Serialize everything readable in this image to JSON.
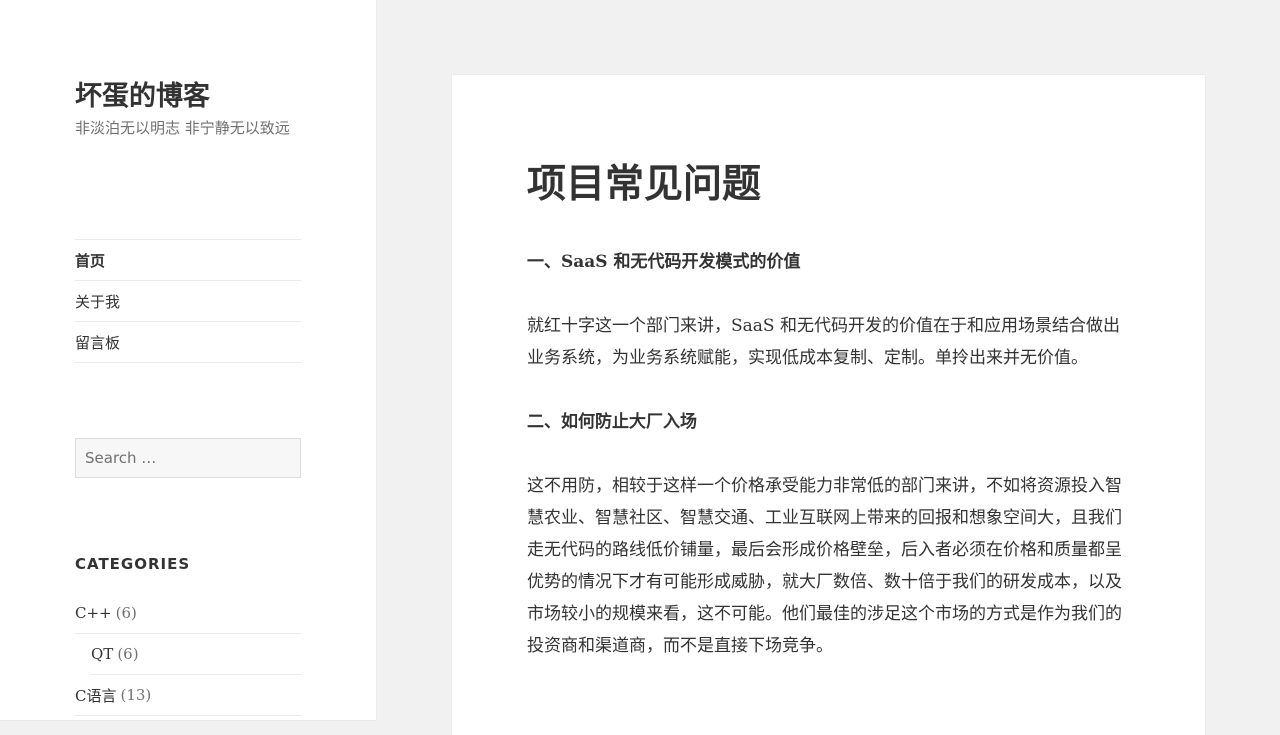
{
  "site": {
    "title": "坏蛋的博客",
    "description": "非淡泊无以明志 非宁静无以致远"
  },
  "nav": {
    "items": [
      {
        "label": "首页"
      },
      {
        "label": "关于我"
      },
      {
        "label": "留言板"
      }
    ]
  },
  "search": {
    "placeholder": "Search …"
  },
  "categories": {
    "title": "CATEGORIES",
    "items": [
      {
        "name": "C++",
        "count": "(6)"
      },
      {
        "name": "QT",
        "count": "(6)"
      },
      {
        "name": "C语言",
        "count": "(13)"
      }
    ]
  },
  "post": {
    "title": "项目常见问题",
    "sections": [
      {
        "heading": "一、SaaS 和无代码开发模式的价值",
        "paragraph": "就红十字这一个部门来讲，SaaS 和无代码开发的价值在于和应用场景结合做出业务系统，为业务系统赋能，实现低成本复制、定制。单拎出来并无价值。"
      },
      {
        "heading": "二、如何防止大厂入场",
        "paragraph": "这不用防，相较于这样一个价格承受能力非常低的部门来讲，不如将资源投入智慧农业、智慧社区、智慧交通、工业互联网上带来的回报和想象空间大，且我们走无代码的路线低价铺量，最后会形成价格壁垒，后入者必须在价格和质量都呈优势的情况下才有可能形成威胁，就大厂数倍、数十倍于我们的研发成本，以及市场较小的规模来看，这不可能。他们最佳的涉足这个市场的方式是作为我们的投资商和渠道商，而不是直接下场竞争。"
      }
    ]
  }
}
